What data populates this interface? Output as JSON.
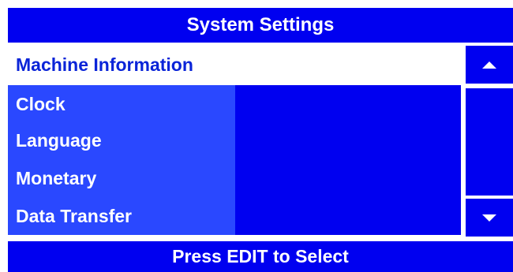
{
  "header": {
    "title": "System Settings"
  },
  "menu": {
    "items": [
      {
        "label": "Machine Information",
        "selected": true
      },
      {
        "label": "Clock",
        "selected": false
      },
      {
        "label": "Language",
        "selected": false
      },
      {
        "label": "Monetary",
        "selected": false
      },
      {
        "label": "Data Transfer",
        "selected": false
      }
    ]
  },
  "scroll": {
    "up_icon": "arrow-up-icon",
    "down_icon": "arrow-down-icon"
  },
  "footer": {
    "hint": "Press EDIT to Select"
  },
  "colors": {
    "panel_blue": "#0000f0",
    "item_blue": "#2a48ff",
    "selected_bg": "#ffffff",
    "selected_text": "#0a24d8"
  }
}
